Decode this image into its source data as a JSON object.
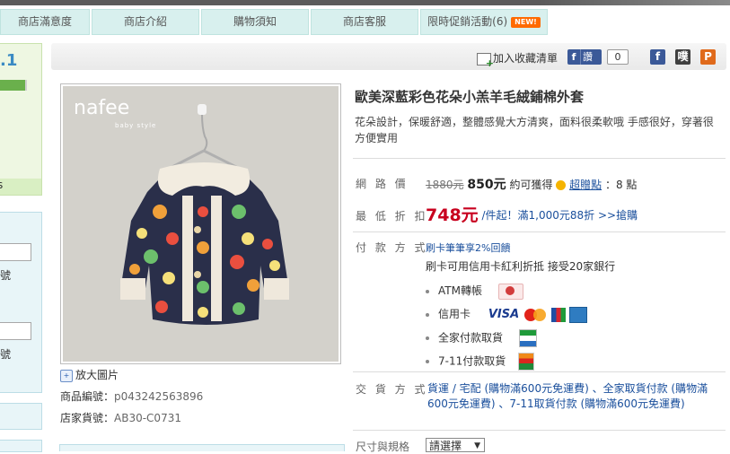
{
  "nav": {
    "tabs": [
      {
        "label": "商店滿意度"
      },
      {
        "label": "商店介紹"
      },
      {
        "label": "購物須知"
      },
      {
        "label": "商店客服"
      },
      {
        "label": "限時促銷活動(6)",
        "badge": "NEW!"
      }
    ]
  },
  "sidebar": {
    "rating_fragment": ".1",
    "footer_fragment": "s",
    "text_fragment_1": "號",
    "text_fragment_2": "號"
  },
  "toolbar": {
    "add_favorite": "加入收藏清單",
    "fb_icon_label": "f",
    "fb_button": "讚",
    "fb_count": "0",
    "share_icons": [
      "facebook-icon",
      "plurk-icon",
      "pixnet-icon"
    ],
    "share_glyphs": [
      "f",
      "噗",
      "P"
    ]
  },
  "image": {
    "brand": "nafee",
    "brand_sub": "baby style",
    "zoom_label": "放大圖片"
  },
  "meta": {
    "product_no_label": "商品編號：",
    "product_no": "p043242563896",
    "store_no_label": "店家貨號：",
    "store_no": "AB30-C0731"
  },
  "product": {
    "title": "歐美深藍彩色花朵小羔羊毛絨鋪棉外套",
    "description": "花朵設計，保暖舒適，整體感覺大方清爽，面料很柔軟哦 手感很好，穿著很方便實用"
  },
  "price": {
    "label": "網 路 價",
    "original": "1880元",
    "current": "850元",
    "earn_text": "約可獲得",
    "points_link": "超贈點",
    "points_value": "：8 點"
  },
  "discount": {
    "label": "最 低 折 扣",
    "value": "748元",
    "text": "/件起！滿1,000元88折 >>搶購"
  },
  "payment": {
    "label": "付 款 方 式",
    "promo": "刷卡筆筆享2%回饋",
    "installment": "刷卡可用信用卡紅利折抵 接受20家銀行",
    "methods": [
      {
        "label": "ATM轉帳",
        "icon": "atm-icon"
      },
      {
        "label": "信用卡",
        "icon": "credit-cards-icon",
        "cards": [
          "VISA",
          "MasterCard",
          "JCB",
          "AMEX"
        ]
      },
      {
        "label": "全家付款取貨",
        "icon": "familymart-icon"
      },
      {
        "label": "7-11付款取貨",
        "icon": "seven-eleven-icon"
      }
    ]
  },
  "shipping": {
    "label": "交 貨 方 式",
    "text": "貨運 / 宅配 (購物滿600元免運費) 、全家取貨付款 (購物滿600元免運費) 、7-11取貨付款 (購物滿600元免運費)"
  },
  "size": {
    "label": "尺寸與規格",
    "select_value": "請選擇"
  },
  "colors": {
    "nav_bg": "#d8f0ee",
    "price_red": "#c8001e",
    "link_blue": "#1a4f9c",
    "badge_orange": "#ff6a00"
  }
}
